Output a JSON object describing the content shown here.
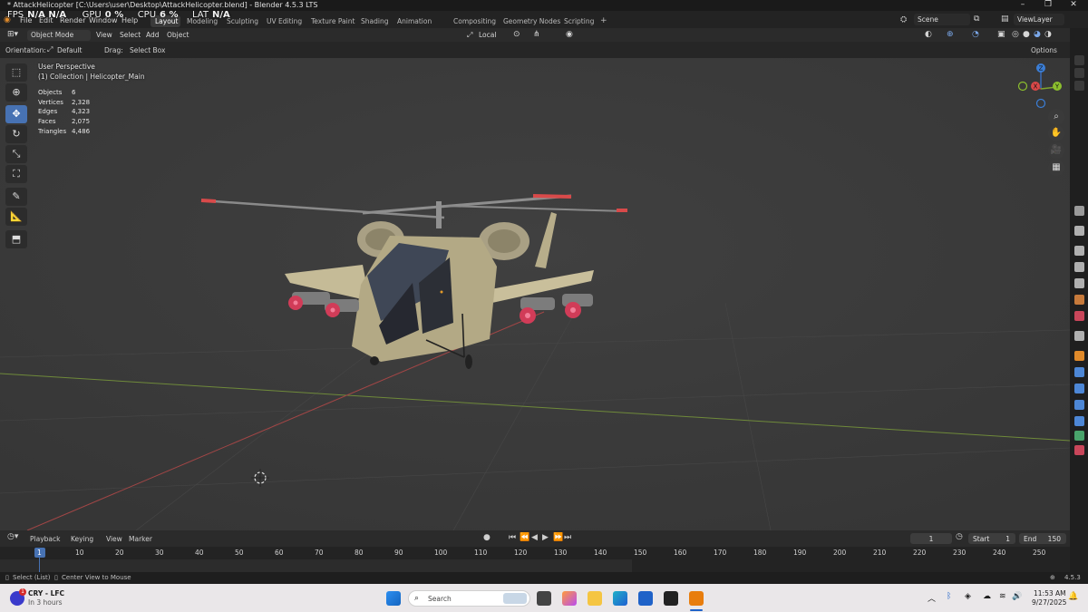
{
  "window": {
    "title": "* AttackHelicopter [C:\\Users\\user\\Desktop\\AttackHelicopter.blend] - Blender 4.5.3 LTS"
  },
  "perf": {
    "fps_label": "FPS",
    "fps_value": "N/A N/A",
    "gpu_label": "GPU",
    "gpu_value": "0 %",
    "cpu_label": "CPU",
    "cpu_value": "6 %",
    "lat_label": "LAT",
    "lat_value": "N/A"
  },
  "menu": {
    "file": "File",
    "edit": "Edit",
    "render": "Render",
    "window": "Window",
    "help": "Help"
  },
  "workspaces": [
    "Layout",
    "Modeling",
    "Sculpting",
    "UV Editing",
    "Texture Paint",
    "Shading",
    "Animation",
    "Compositing",
    "Geometry Nodes",
    "Scripting"
  ],
  "scene": {
    "scene_name": "Scene",
    "view_layer": "ViewLayer"
  },
  "viewport_header": {
    "mode": "Object Mode",
    "view": "View",
    "select": "Select",
    "add": "Add",
    "object": "Object",
    "transform_orientation": "Local"
  },
  "tool_settings": {
    "orientation_label": "Orientation:",
    "orientation_value": "Default",
    "drag_label": "Drag:",
    "drag_value": "Select Box",
    "options": "Options"
  },
  "overlay": {
    "view_name": "User Perspective",
    "collection": "(1) Collection | Helicopter_Main",
    "stats": [
      {
        "label": "Objects",
        "value": "6"
      },
      {
        "label": "Vertices",
        "value": "2,328"
      },
      {
        "label": "Edges",
        "value": "4,323"
      },
      {
        "label": "Faces",
        "value": "2,075"
      },
      {
        "label": "Triangles",
        "value": "4,486"
      }
    ]
  },
  "gizmo": {
    "x": "X",
    "y": "Y",
    "z": "Z"
  },
  "timeline": {
    "playback": "Playback",
    "keying": "Keying",
    "view": "View",
    "marker": "Marker",
    "current_frame": "1",
    "start_label": "Start",
    "start_value": "1",
    "end_label": "End",
    "end_value": "150",
    "ruler": [
      "1",
      "10",
      "20",
      "30",
      "40",
      "50",
      "60",
      "70",
      "80",
      "90",
      "100",
      "110",
      "120",
      "130",
      "140",
      "150",
      "160",
      "170",
      "180",
      "190",
      "200",
      "210",
      "220",
      "230",
      "240",
      "250"
    ]
  },
  "status": {
    "left1": "Select (List)",
    "left2": "Center View to Mouse",
    "version": "4.5.3"
  },
  "taskbar": {
    "weather_title": "CRY - LFC",
    "weather_sub": "In 3 hours",
    "search_placeholder": "Search",
    "time": "11:53 AM",
    "date": "9/27/2025",
    "notification_badge": "1"
  },
  "colors": {
    "viewport_bg": "#3c3c3c",
    "x_axis": "#b34a4a",
    "y_axis": "#7b9a3a",
    "active_blue": "#4772b3",
    "heli_body": "#b7ad8a"
  }
}
